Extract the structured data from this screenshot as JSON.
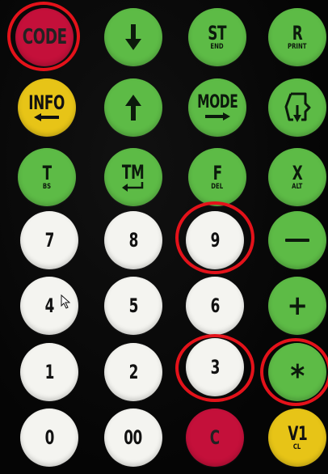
{
  "keypad": {
    "keys": {
      "code": {
        "label": "CODE"
      },
      "down": {
        "icon": "arrow-down-icon"
      },
      "st": {
        "label": "ST",
        "sub": "END"
      },
      "r": {
        "label": "R",
        "sub": "PRINT"
      },
      "info": {
        "label": "INFO",
        "icon": "arrow-left-icon"
      },
      "up": {
        "icon": "arrow-up-icon"
      },
      "mode": {
        "label": "MODE",
        "icon": "arrow-right-icon"
      },
      "page": {
        "icon": "page-return-icon"
      },
      "t": {
        "label": "T",
        "sub": "BS"
      },
      "tm": {
        "label": "TM",
        "icon": "enter-icon"
      },
      "f": {
        "label": "F",
        "sub": "DEL"
      },
      "x": {
        "label": "X",
        "sub": "ALT"
      },
      "d7": {
        "label": "7"
      },
      "d8": {
        "label": "8"
      },
      "d9": {
        "label": "9"
      },
      "minus": {
        "icon": "minus-icon"
      },
      "d4": {
        "label": "4"
      },
      "d5": {
        "label": "5"
      },
      "d6": {
        "label": "6"
      },
      "plus": {
        "label": "+"
      },
      "d1": {
        "label": "1"
      },
      "d2": {
        "label": "2"
      },
      "d3": {
        "label": "3"
      },
      "star": {
        "label": "*"
      },
      "d0": {
        "label": "0"
      },
      "d00": {
        "label": "00"
      },
      "c": {
        "label": "C"
      },
      "v1": {
        "label": "V1",
        "sub": "CL"
      }
    },
    "colors": {
      "background": "#050505",
      "green": "#5dbb46",
      "white": "#f4f4f0",
      "red": "#c4103a",
      "yellow": "#e7c417",
      "highlight_ring": "#e4121a"
    },
    "highlighted_keys": [
      "CODE",
      "9",
      "3",
      "*"
    ]
  }
}
